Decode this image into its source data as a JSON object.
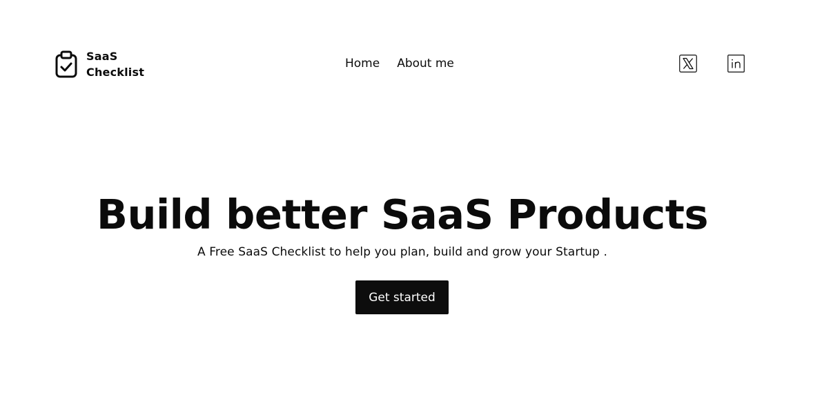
{
  "header": {
    "logo": {
      "icon": "clipboard-check-icon",
      "line1": "SaaS",
      "line2": "Checklist"
    },
    "nav": [
      {
        "label": "Home"
      },
      {
        "label": "About me"
      }
    ],
    "social": [
      {
        "icon": "x-twitter-icon"
      },
      {
        "icon": "linkedin-icon"
      }
    ]
  },
  "hero": {
    "title": "Build better SaaS Products",
    "subtitle": "A Free SaaS Checklist to help you plan, build and grow your Startup .",
    "cta_label": "Get started"
  },
  "colors": {
    "text": "#0b0b0b",
    "background": "#ffffff",
    "button": "#0d0d0d",
    "button_text": "#ffffff"
  }
}
